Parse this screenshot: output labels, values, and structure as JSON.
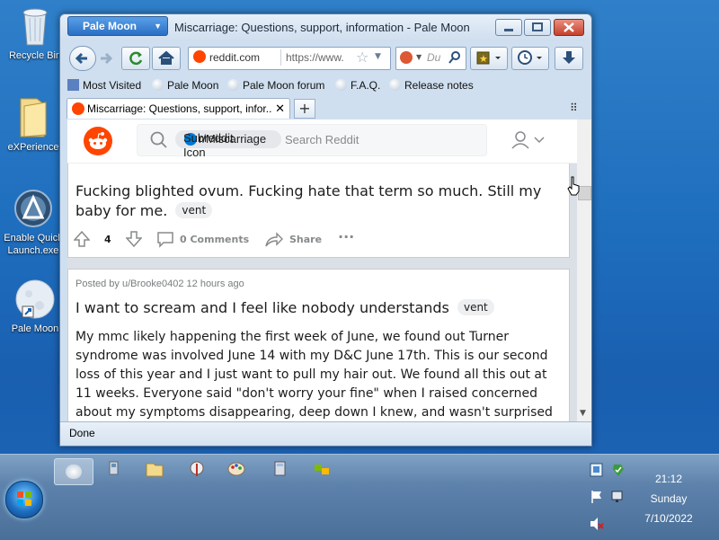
{
  "desktop": {
    "icons": [
      {
        "label": "Recycle Bin"
      },
      {
        "label": "eXPerience"
      },
      {
        "label": "Enable Quick Launch.exe"
      },
      {
        "label": "Pale Moon"
      }
    ]
  },
  "window": {
    "app_button": "Pale Moon",
    "title": "Miscarriage: Questions, support, information - Pale Moon",
    "url_site": "reddit.com",
    "url_text": "https://www.",
    "search_placeholder": "Du",
    "bookmarks": [
      "Most Visited",
      "Pale Moon",
      "Pale Moon forum",
      "F.A.Q.",
      "Release notes"
    ],
    "tab_title": "Miscarriage: Questions, support, infor...",
    "status": "Done"
  },
  "reddit": {
    "search_placeholder": "Search Reddit",
    "chip_label": "r/Miscarriage",
    "chip_alt": "Subreddit Icon",
    "post1": {
      "title": "Fucking blighted ovum. Fucking hate that term so much. Still my baby for me.",
      "flair": "vent",
      "votes": "4",
      "comments": "0 Comments",
      "share": "Share",
      "more": "···"
    },
    "post2": {
      "meta": "Posted by u/Brooke0402 12 hours ago",
      "title": "I want to scream and I feel like nobody understands",
      "flair": "vent",
      "body": "My mmc likely happening the first week of June, we found out Turner syndrome was involved June 14 with my D&C June 17th. This is our second loss of this year and I just want to pull my hair out. We found all this out at 11 weeks. Everyone said \"don't worry your fine\" when I raised concerned about my symptoms disappearing, deep down I knew, and wasn't surprised at all when we found no heart beat at the next scan. Still I sobbed with my husband as we were AGAIN"
    }
  },
  "taskbar": {
    "time": "21:12",
    "day": "Sunday",
    "date": "7/10/2022"
  },
  "colors": {
    "reddit_orange": "#ff4500",
    "desktop_blue": "#1f6fbf",
    "link_blue": "#0079d3"
  }
}
